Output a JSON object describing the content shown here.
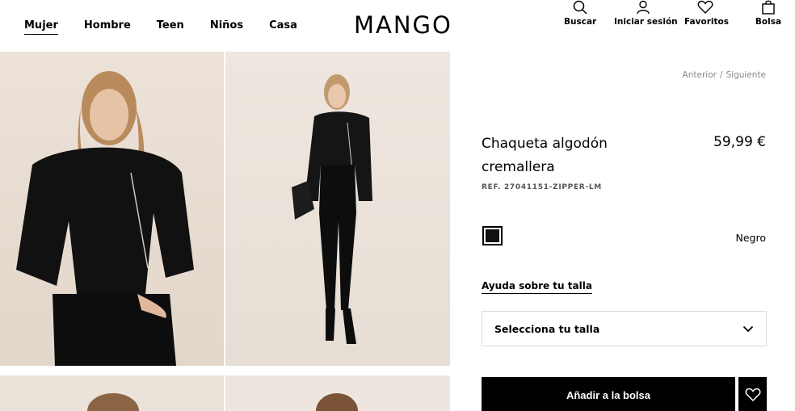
{
  "nav": {
    "items": [
      "Mujer",
      "Hombre",
      "Teen",
      "Niños",
      "Casa"
    ],
    "active": "Mujer"
  },
  "brand": {
    "logo": "MANGO"
  },
  "tools": {
    "search": "Buscar",
    "login": "Iniciar sesión",
    "favorites": "Favoritos",
    "bag": "Bolsa"
  },
  "product": {
    "prev": "Anterior",
    "separator": "/",
    "next": "Siguiente",
    "name": "Chaqueta algodón cremallera",
    "price": "59,99 €",
    "ref": "REF. 27041151-ZIPPER-LM",
    "color_name": "Negro",
    "swatch_color": "#111111",
    "size_help": "Ayuda sobre tu talla",
    "size_select": "Selecciona tu talla",
    "add_to_bag": "Añadir a la bolsa"
  },
  "icons": {
    "search": "search-icon",
    "login": "user-icon",
    "favorites": "heart-icon",
    "bag": "bag-icon",
    "select": "chevron-down-icon",
    "fav_button": "heart-icon"
  }
}
